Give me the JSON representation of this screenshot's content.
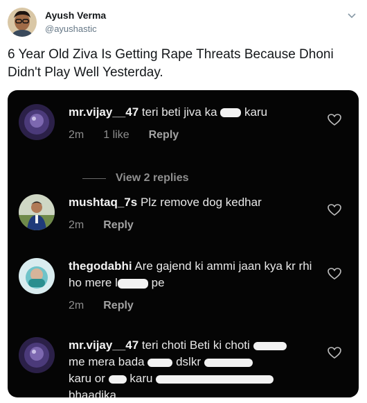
{
  "tweet": {
    "author_name": "Ayush Verma",
    "author_handle": "@ayushastic",
    "text": "6 Year Old Ziva Is Getting Rape Threats Because Dhoni Didn't Play Well Yesterday."
  },
  "comments": [
    {
      "username": "mr.vijay__47",
      "text_before": "teri beti jiva ka",
      "text_after": "karu",
      "time": "2m",
      "likes": "1 like",
      "reply": "Reply",
      "view_replies": "View 2 replies"
    },
    {
      "username": "mushtaq_7s",
      "text": "Plz remove dog kedhar",
      "time": "2m",
      "reply": "Reply"
    },
    {
      "username": "thegodabhi",
      "text_before": "Are gajend ki ammi jaan kya kr rhi ho mere l",
      "text_after": "pe",
      "time": "2m",
      "reply": "Reply"
    },
    {
      "username": "mr.vijay__47",
      "text_1": "teri choti Beti ki choti",
      "text_2": "me mera bada",
      "text_3": "dslkr",
      "text_4": "karu or",
      "text_5": "karu",
      "text_6": "bhaadika"
    }
  ],
  "colors": {
    "media_bg": "#050505",
    "comment_text": "#e8e8e8",
    "meta_text": "#8f8f8f",
    "handle": "#657786"
  }
}
